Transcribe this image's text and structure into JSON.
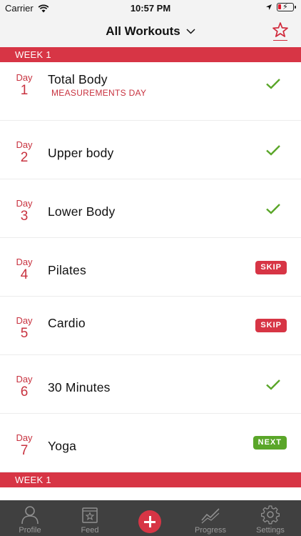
{
  "status_bar": {
    "carrier": "Carrier",
    "time": "10:57 PM"
  },
  "nav": {
    "title": "All Workouts"
  },
  "weeks": [
    {
      "label": "WEEK 1",
      "days": [
        {
          "day_label": "Day",
          "day_num": "1",
          "name": "Total Body",
          "subtitle": "MEASUREMENTS DAY",
          "status": "check"
        },
        {
          "day_label": "Day",
          "day_num": "2",
          "name": "Upper body",
          "status": "check"
        },
        {
          "day_label": "Day",
          "day_num": "3",
          "name": "Lower Body",
          "status": "check"
        },
        {
          "day_label": "Day",
          "day_num": "4",
          "name": "Pilates",
          "status": "SKIP"
        },
        {
          "day_label": "Day",
          "day_num": "5",
          "name": "Cardio",
          "status": "SKIP"
        },
        {
          "day_label": "Day",
          "day_num": "6",
          "name": "30 Minutes",
          "status": "check"
        },
        {
          "day_label": "Day",
          "day_num": "7",
          "name": "Yoga",
          "status": "NEXT"
        }
      ]
    },
    {
      "label": "WEEK 1"
    }
  ],
  "tabs": {
    "profile": "Profile",
    "feed": "Feed",
    "progress": "Progress",
    "settings": "Settings"
  },
  "colors": {
    "accent": "#d73545",
    "check": "#5aa629",
    "next": "#5aa629",
    "tabbar": "#404040"
  }
}
